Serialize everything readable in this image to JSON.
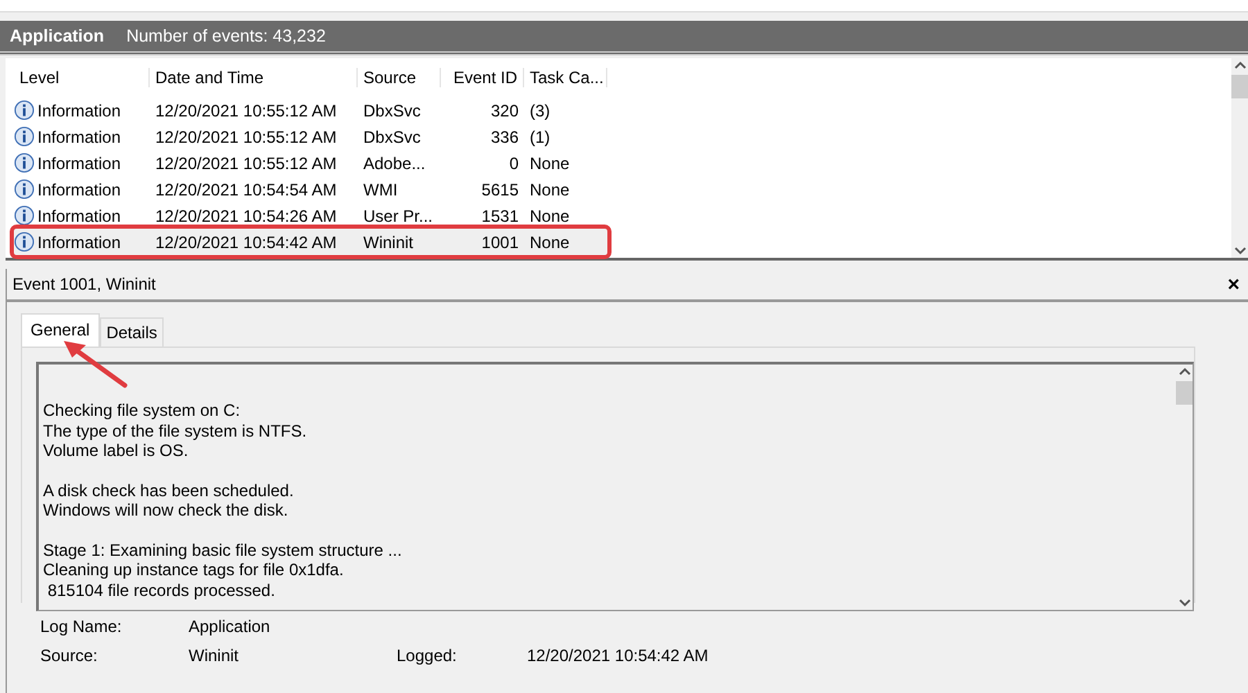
{
  "header": {
    "title": "Application",
    "count": "Number of events: 43,232"
  },
  "table": {
    "columns": [
      "Level",
      "Date and Time",
      "Source",
      "Event ID",
      "Task Ca..."
    ],
    "rows": [
      {
        "level": "Information",
        "date": "12/20/2021 10:55:12 AM",
        "source": "DbxSvc",
        "event_id": "320",
        "task": "(3)",
        "selected": false,
        "highlighted": false
      },
      {
        "level": "Information",
        "date": "12/20/2021 10:55:12 AM",
        "source": "DbxSvc",
        "event_id": "336",
        "task": "(1)",
        "selected": false,
        "highlighted": false
      },
      {
        "level": "Information",
        "date": "12/20/2021 10:55:12 AM",
        "source": "Adobe...",
        "event_id": "0",
        "task": "None",
        "selected": false,
        "highlighted": false
      },
      {
        "level": "Information",
        "date": "12/20/2021 10:54:54 AM",
        "source": "WMI",
        "event_id": "5615",
        "task": "None",
        "selected": false,
        "highlighted": false
      },
      {
        "level": "Information",
        "date": "12/20/2021 10:54:26 AM",
        "source": "User Pr...",
        "event_id": "1531",
        "task": "None",
        "selected": false,
        "highlighted": false
      },
      {
        "level": "Information",
        "date": "12/20/2021 10:54:42 AM",
        "source": "Wininit",
        "event_id": "1001",
        "task": "None",
        "selected": true,
        "highlighted": true
      }
    ]
  },
  "detail": {
    "title": "Event 1001, Wininit",
    "close": "×",
    "tabs": [
      {
        "label": "General",
        "selected": true
      },
      {
        "label": "Details",
        "selected": false
      }
    ],
    "message": [
      [
        "Checking file system on C:",
        "The type of the file system is NTFS.",
        "Volume label is OS."
      ],
      [
        "A disk check has been scheduled.",
        "Windows will now check the disk."
      ],
      [
        "Stage 1: Examining basic file system structure ...",
        "Cleaning up instance tags for file 0x1dfa.",
        " 815104 file records processed."
      ]
    ],
    "fields": [
      {
        "label": "Log Name:",
        "value": "Application"
      },
      {
        "label": "Source:",
        "value": "Wininit",
        "label2": "Logged:",
        "value2": "12/20/2021 10:54:42 AM"
      }
    ]
  }
}
